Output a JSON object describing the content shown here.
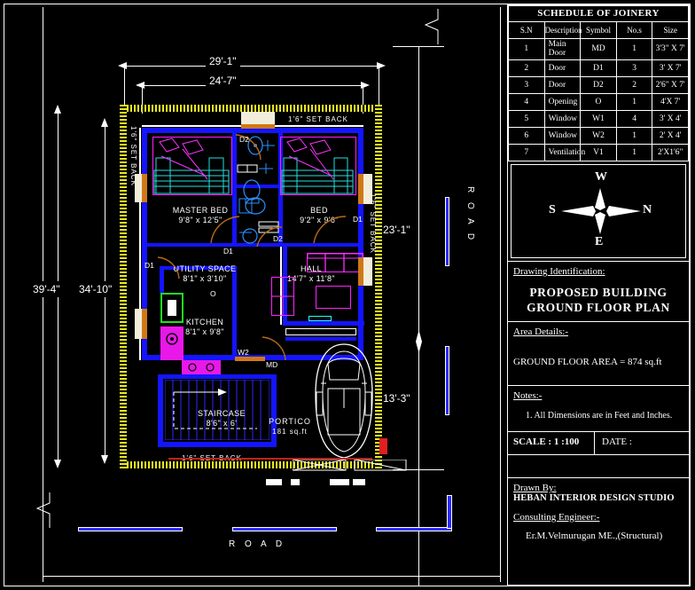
{
  "schedule": {
    "title": "SCHEDULE OF JOINERY",
    "headers": [
      "S.N",
      "Description",
      "Symbol",
      "No.s",
      "Size"
    ],
    "rows": [
      {
        "sn": "1",
        "description": "Main Door",
        "symbol": "MD",
        "nos": "1",
        "size": "3'3\" X 7'"
      },
      {
        "sn": "2",
        "description": "Door",
        "symbol": "D1",
        "nos": "3",
        "size": "3' X 7'"
      },
      {
        "sn": "3",
        "description": "Door",
        "symbol": "D2",
        "nos": "2",
        "size": "2'6\" X 7'"
      },
      {
        "sn": "4",
        "description": "Opening",
        "symbol": "O",
        "nos": "1",
        "size": "4'X 7'"
      },
      {
        "sn": "5",
        "description": "Window",
        "symbol": "W1",
        "nos": "4",
        "size": "3' X 4'"
      },
      {
        "sn": "6",
        "description": "Window",
        "symbol": "W2",
        "nos": "1",
        "size": "2' X 4'"
      },
      {
        "sn": "7",
        "description": "Ventilation",
        "symbol": "V1",
        "nos": "1",
        "size": "2'X1'6\""
      }
    ]
  },
  "compass": {
    "top": "W",
    "right": "N",
    "bottom": "E",
    "left": "S"
  },
  "drawing_identification": {
    "label": "Drawing Identification:",
    "line1": "PROPOSED BUILDING",
    "line2": "GROUND FLOOR PLAN"
  },
  "area_details": {
    "label": "Area Details:-",
    "text": "GROUND FLOOR AREA = 874 sq.ft"
  },
  "notes": {
    "label": "Notes:-",
    "items": [
      "1. All Dimensions are in Feet and Inches."
    ]
  },
  "scale_row": {
    "scale": "SCALE : 1 :100",
    "date": "DATE :"
  },
  "drawn_by": {
    "label": "Drawn By:",
    "value": "HEBAN INTERIOR DESIGN STUDIO"
  },
  "consulting_engineer": {
    "label": "Consulting Engineer:-",
    "value": "Er.M.Velmurugan ME.,(Structural)"
  },
  "dimensions": {
    "top_outer": "29'-1\"",
    "top_inner": "24'-7\"",
    "left_outer": "39'-4\"",
    "left_inner": "34'-10\"",
    "right_upper": "23'-1\"",
    "right_lower": "13'-3\""
  },
  "setbacks": {
    "top": "1'6\" SET BACK",
    "left": "1'6\" SET BACK",
    "right": "1'6\" SET BACK",
    "bottom": "1'6\" SET BACK"
  },
  "roads": {
    "right": "R O A D",
    "bottom": "R O A D"
  },
  "rooms": [
    {
      "name": "MASTER BED",
      "size": "9'8\" x 12'5\""
    },
    {
      "name": "BED",
      "size": "9'2\" x 9'6\""
    },
    {
      "name": "UTILITY SPACE",
      "size": "8'1\" x 3'10\""
    },
    {
      "name": "KITCHEN",
      "size": "8'1\" x 9'8\""
    },
    {
      "name": "HALL",
      "size": "14'7\" x 11'8\""
    },
    {
      "name": "STAIRCASE",
      "size": "8'6\" x 6'"
    },
    {
      "name": "PORTICO",
      "size": "181 sq.ft"
    }
  ],
  "door_tags": {
    "d2_top_left": "D2",
    "d2_mid": "D2",
    "d1_bed": "D1",
    "d1_master": "D1",
    "d1_left": "D1",
    "o_utility": "O",
    "w2": "W2",
    "md": "MD"
  },
  "colors": {
    "background": "#000000",
    "wall": "#1414ff",
    "plot_hatch": "#e8e820",
    "furniture": "#ff22ff",
    "door_swing": "#b06a1a",
    "text": "#ffffff"
  }
}
